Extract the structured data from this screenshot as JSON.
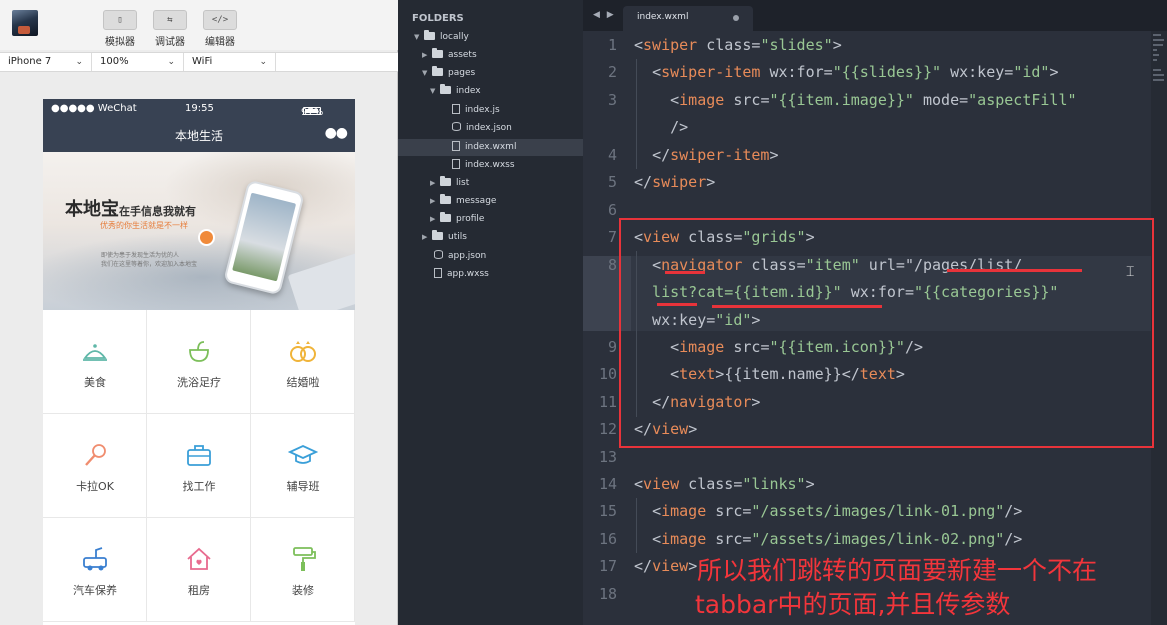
{
  "toolbar": {
    "tools": [
      {
        "icon": "phone-icon",
        "glyph": "▯",
        "label": "模拟器"
      },
      {
        "icon": "debug-icon",
        "glyph": "⇆",
        "label": "调试器"
      },
      {
        "icon": "code-icon",
        "glyph": "</>",
        "label": "编辑器"
      }
    ],
    "device": "iPhone 7",
    "zoom": "100%",
    "network": "WiFi"
  },
  "phone": {
    "status": {
      "carrier": "●●●●● WeChat",
      "time": "19:55",
      "battery": "97%"
    },
    "nav_title": "本地生活",
    "nav_more": "●●",
    "banner": {
      "title": "本地宝",
      "title_suffix": "在手信息我就有",
      "subtitle": "优秀的你生活就是不一样",
      "line1": "即使为患于发现生活为优的人",
      "line2": "我们在这里等着你，欢迎加入本地宝"
    },
    "grid": [
      {
        "name": "美食",
        "icon": "food-icon"
      },
      {
        "name": "洗浴足疗",
        "icon": "bath-icon"
      },
      {
        "name": "结婚啦",
        "icon": "rings-icon"
      },
      {
        "name": "卡拉OK",
        "icon": "microphone-icon"
      },
      {
        "name": "找工作",
        "icon": "briefcase-icon"
      },
      {
        "name": "辅导班",
        "icon": "graduation-cap-icon"
      },
      {
        "name": "汽车保养",
        "icon": "car-icon"
      },
      {
        "name": "租房",
        "icon": "house-icon"
      },
      {
        "name": "装修",
        "icon": "paint-roller-icon"
      }
    ],
    "colors": {
      "navbar": "#384253"
    }
  },
  "sidebar": {
    "header": "FOLDERS",
    "tree": [
      {
        "label": "locally",
        "type": "folder",
        "open": true
      },
      {
        "label": "assets",
        "type": "folder",
        "open": false
      },
      {
        "label": "pages",
        "type": "folder",
        "open": true
      },
      {
        "label": "index",
        "type": "folder",
        "open": true
      },
      {
        "label": "index.js",
        "type": "file"
      },
      {
        "label": "index.json",
        "type": "file"
      },
      {
        "label": "index.wxml",
        "type": "file",
        "selected": true
      },
      {
        "label": "index.wxss",
        "type": "file"
      },
      {
        "label": "list",
        "type": "folder",
        "open": false
      },
      {
        "label": "message",
        "type": "folder",
        "open": false
      },
      {
        "label": "profile",
        "type": "folder",
        "open": false
      },
      {
        "label": "utils",
        "type": "folder",
        "open": false
      },
      {
        "label": "app.json",
        "type": "file"
      },
      {
        "label": "app.wxss",
        "type": "file"
      }
    ]
  },
  "editor": {
    "nav_arrows": "◀ ▶",
    "tab": "index.wxml",
    "line_numbers": [
      "1",
      "2",
      "3",
      "",
      "4",
      "5",
      "6",
      "7",
      "8",
      "",
      "",
      "9",
      "10",
      "11",
      "12",
      "13",
      "14",
      "15",
      "16",
      "17",
      "18"
    ],
    "lines": [
      "<swiper class=\"slides\">",
      "  <swiper-item wx:for=\"{{slides}}\" wx:key=\"id\">",
      "    <image src=\"{{item.image}}\" mode=\"aspectFill\"",
      "    />",
      "  </swiper-item>",
      "</swiper>",
      "",
      "<view class=\"grids\">",
      "  <navigator class=\"item\" url=\"/pages/list/",
      "  list?cat={{item.id}}\" wx:for=\"{{categories}}\"",
      "  wx:key=\"id\">",
      "    <image src=\"{{item.icon}}\"/>",
      "    <text>{{item.name}}</text>",
      "  </navigator>",
      "</view>",
      "",
      "<view class=\"links\">",
      "  <image src=\"/assets/images/link-01.png\"/>",
      "  <image src=\"/assets/images/link-02.png\"/>",
      "</view>",
      ""
    ]
  },
  "annotation": {
    "line1": "所以我们跳转的页面要新建一个不在",
    "line2": "tabbar中的页面,并且传参数",
    "color": "#e8333a"
  }
}
